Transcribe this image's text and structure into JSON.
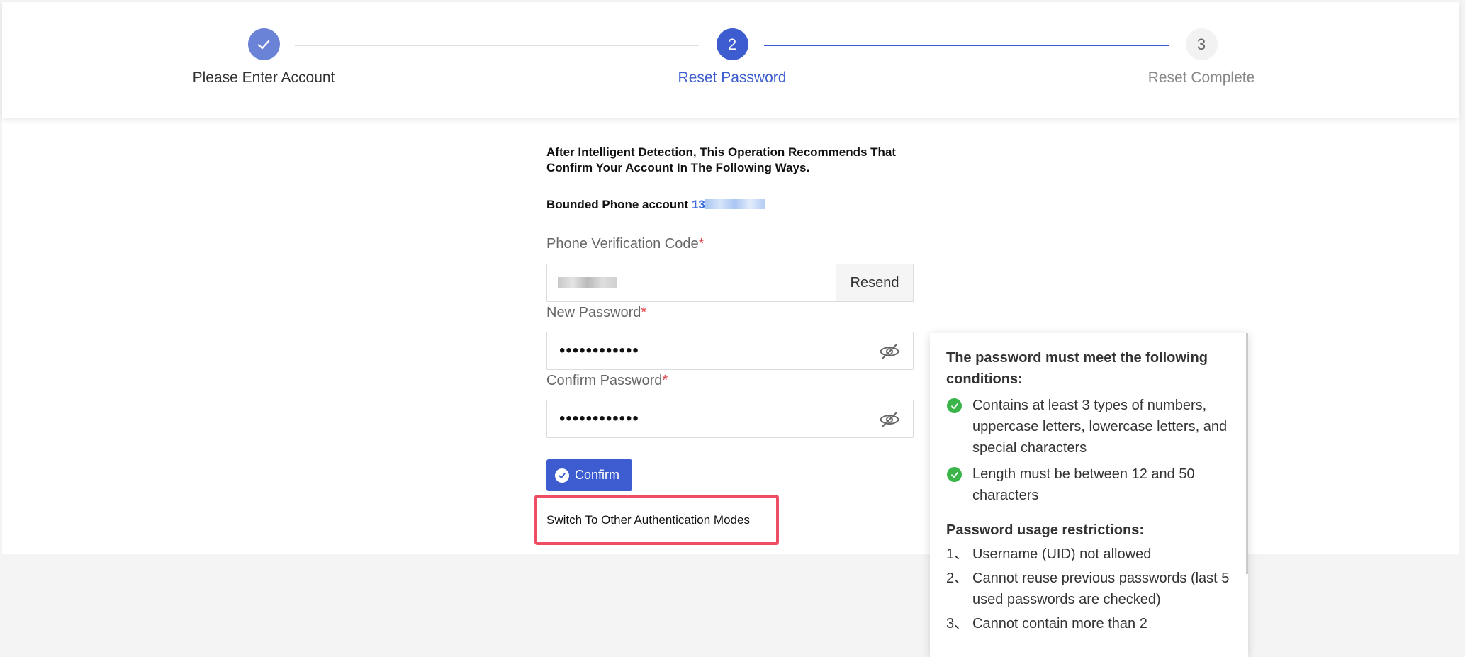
{
  "steps": [
    {
      "label": "Please Enter Account",
      "state": "done",
      "icon": "check-icon"
    },
    {
      "label": "Reset Password",
      "number": "2",
      "state": "active"
    },
    {
      "label": "Reset Complete",
      "number": "3",
      "state": "pending"
    }
  ],
  "form": {
    "notice": "After Intelligent Detection, This Operation Recommends That Confirm Your Account In The Following Ways.",
    "bound_label": "Bounded Phone account",
    "bound_phone_prefix": "13",
    "code_label": "Phone Verification Code",
    "required_mark": "*",
    "resend_label": "Resend",
    "new_password_label": "New Password",
    "new_password_value": "••••••••••••",
    "confirm_password_label": "Confirm Password",
    "confirm_password_value": "••••••••••••",
    "confirm_button": "Confirm",
    "switch_link": "Switch To Other Authentication Modes"
  },
  "popover": {
    "title": "The password must meet the following conditions:",
    "conditions": [
      "Contains at least 3 types of numbers, uppercase letters, lowercase letters, and special characters",
      "Length must be between 12 and 50 characters"
    ],
    "restrictions_title": "Password usage restrictions:",
    "restrictions": [
      {
        "num": "1、",
        "text": "Username (UID) not allowed"
      },
      {
        "num": "2、",
        "text": "Cannot reuse previous passwords (last 5 used passwords are checked)"
      },
      {
        "num": "3、",
        "text": "Cannot contain more than 2"
      }
    ]
  },
  "colors": {
    "primary": "#3c5ccf",
    "done_step": "#6b83d6",
    "success": "#3bb54a",
    "required": "#e0464a",
    "highlight_box": "#ee4d63"
  }
}
